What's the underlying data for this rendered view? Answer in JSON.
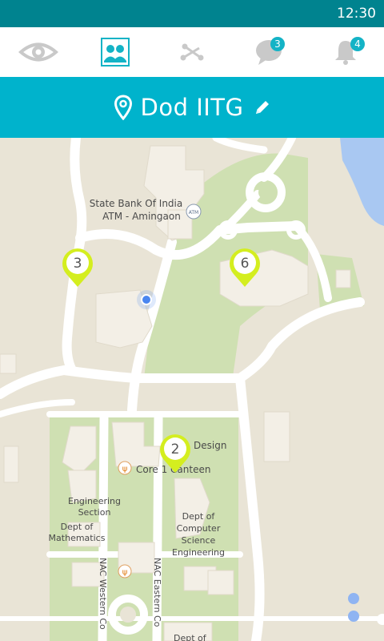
{
  "status_bar": {
    "time": "12:30"
  },
  "tabs": [
    {
      "icon": "eye-icon",
      "badge": ""
    },
    {
      "icon": "people-icon",
      "badge": ""
    },
    {
      "icon": "route-icon",
      "badge": ""
    },
    {
      "icon": "chat-bubble-icon",
      "badge": "3"
    },
    {
      "icon": "bell-icon",
      "badge": "4"
    }
  ],
  "location_header": {
    "icon": "location-pin-icon",
    "title": "Dod IITG",
    "edit_icon": "pencil-icon"
  },
  "map": {
    "labels": {
      "bank_line1": "State Bank Of India",
      "bank_line2": "ATM - Amingaon",
      "atm_badge": "ATM",
      "design": "Design",
      "canteen": "Core 1 Canteen",
      "eng_line1": "Engineering",
      "eng_line2": "Section",
      "math_line1": "Dept of",
      "math_line2": "Mathematics",
      "cse_line1": "Dept of",
      "cse_line2": "Computer",
      "cse_line3": "Science",
      "cse_line4": "Engineering",
      "road_west": "NAC Western Co",
      "road_east": "NAC Eastern Co",
      "dept_bottom": "Dept of"
    },
    "markers": [
      {
        "id": "marker-3",
        "count": "3"
      },
      {
        "id": "marker-6",
        "count": "6"
      },
      {
        "id": "marker-2",
        "count": "2"
      }
    ]
  },
  "colors": {
    "status_bar": "#00838f",
    "title_bar": "#00b3cc",
    "badge": "#14b3c6",
    "marker": "#d4ee1f",
    "map_land": "#e9e4d6",
    "map_green": "#cfe0b2",
    "map_water": "#a9c8f2"
  }
}
